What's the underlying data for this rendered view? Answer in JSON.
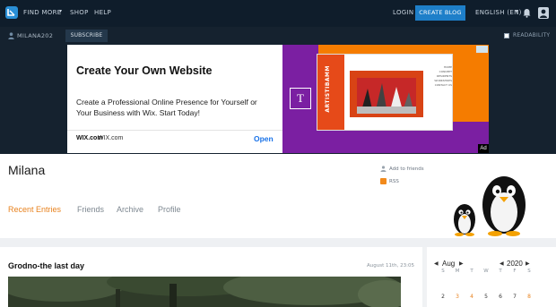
{
  "topnav": {
    "links": [
      "FIND MORE",
      "SHOP",
      "HELP"
    ],
    "login": "LOGIN",
    "create_blog": "CREATE BLOG",
    "language": "ENGLISH (EN)"
  },
  "subbar": {
    "username": "MILANA202",
    "subscribe": "SUBSCRIBE",
    "readability": "READABILITY"
  },
  "ad": {
    "title": "Create Your Own Website",
    "body": "Create a Professional Online Presence for Yourself or Your Business with Wix. Start Today!",
    "wix_logo": "WIX.com",
    "url": "WIX.com",
    "cta": "Open",
    "brand": "ARTISTIBAMM",
    "badge_letter": "T",
    "menu": [
      "HOME",
      "CONCEPT",
      "RESIDENTS",
      "WORKSHOPS",
      "CONTACT US"
    ],
    "ad_label": "Ad"
  },
  "journal": {
    "title": "Milana",
    "add_to_friends": "Add to friends",
    "rss": "RSS",
    "tabs": [
      {
        "label": "Recent Entries",
        "active": true
      },
      {
        "label": "Friends",
        "active": false
      },
      {
        "label": "Archive",
        "active": false
      },
      {
        "label": "Profile",
        "active": false
      }
    ]
  },
  "entry": {
    "title": "Grodno-the last day",
    "date": "August 11th, 23:05"
  },
  "calendar": {
    "month": "Aug",
    "year": "2020",
    "days_of_week": [
      "S",
      "M",
      "T",
      "W",
      "T",
      "F",
      "S"
    ],
    "first_row": [
      {
        "day": "2",
        "linked": false
      },
      {
        "day": "3",
        "linked": true
      },
      {
        "day": "4",
        "linked": true
      },
      {
        "day": "5",
        "linked": false
      },
      {
        "day": "6",
        "linked": false
      },
      {
        "day": "7",
        "linked": false
      },
      {
        "day": "8",
        "linked": true
      }
    ]
  },
  "colors": {
    "accent": "#e8821e",
    "nav_bg": "#0f1d2b",
    "button_blue": "#1e7fc9"
  }
}
